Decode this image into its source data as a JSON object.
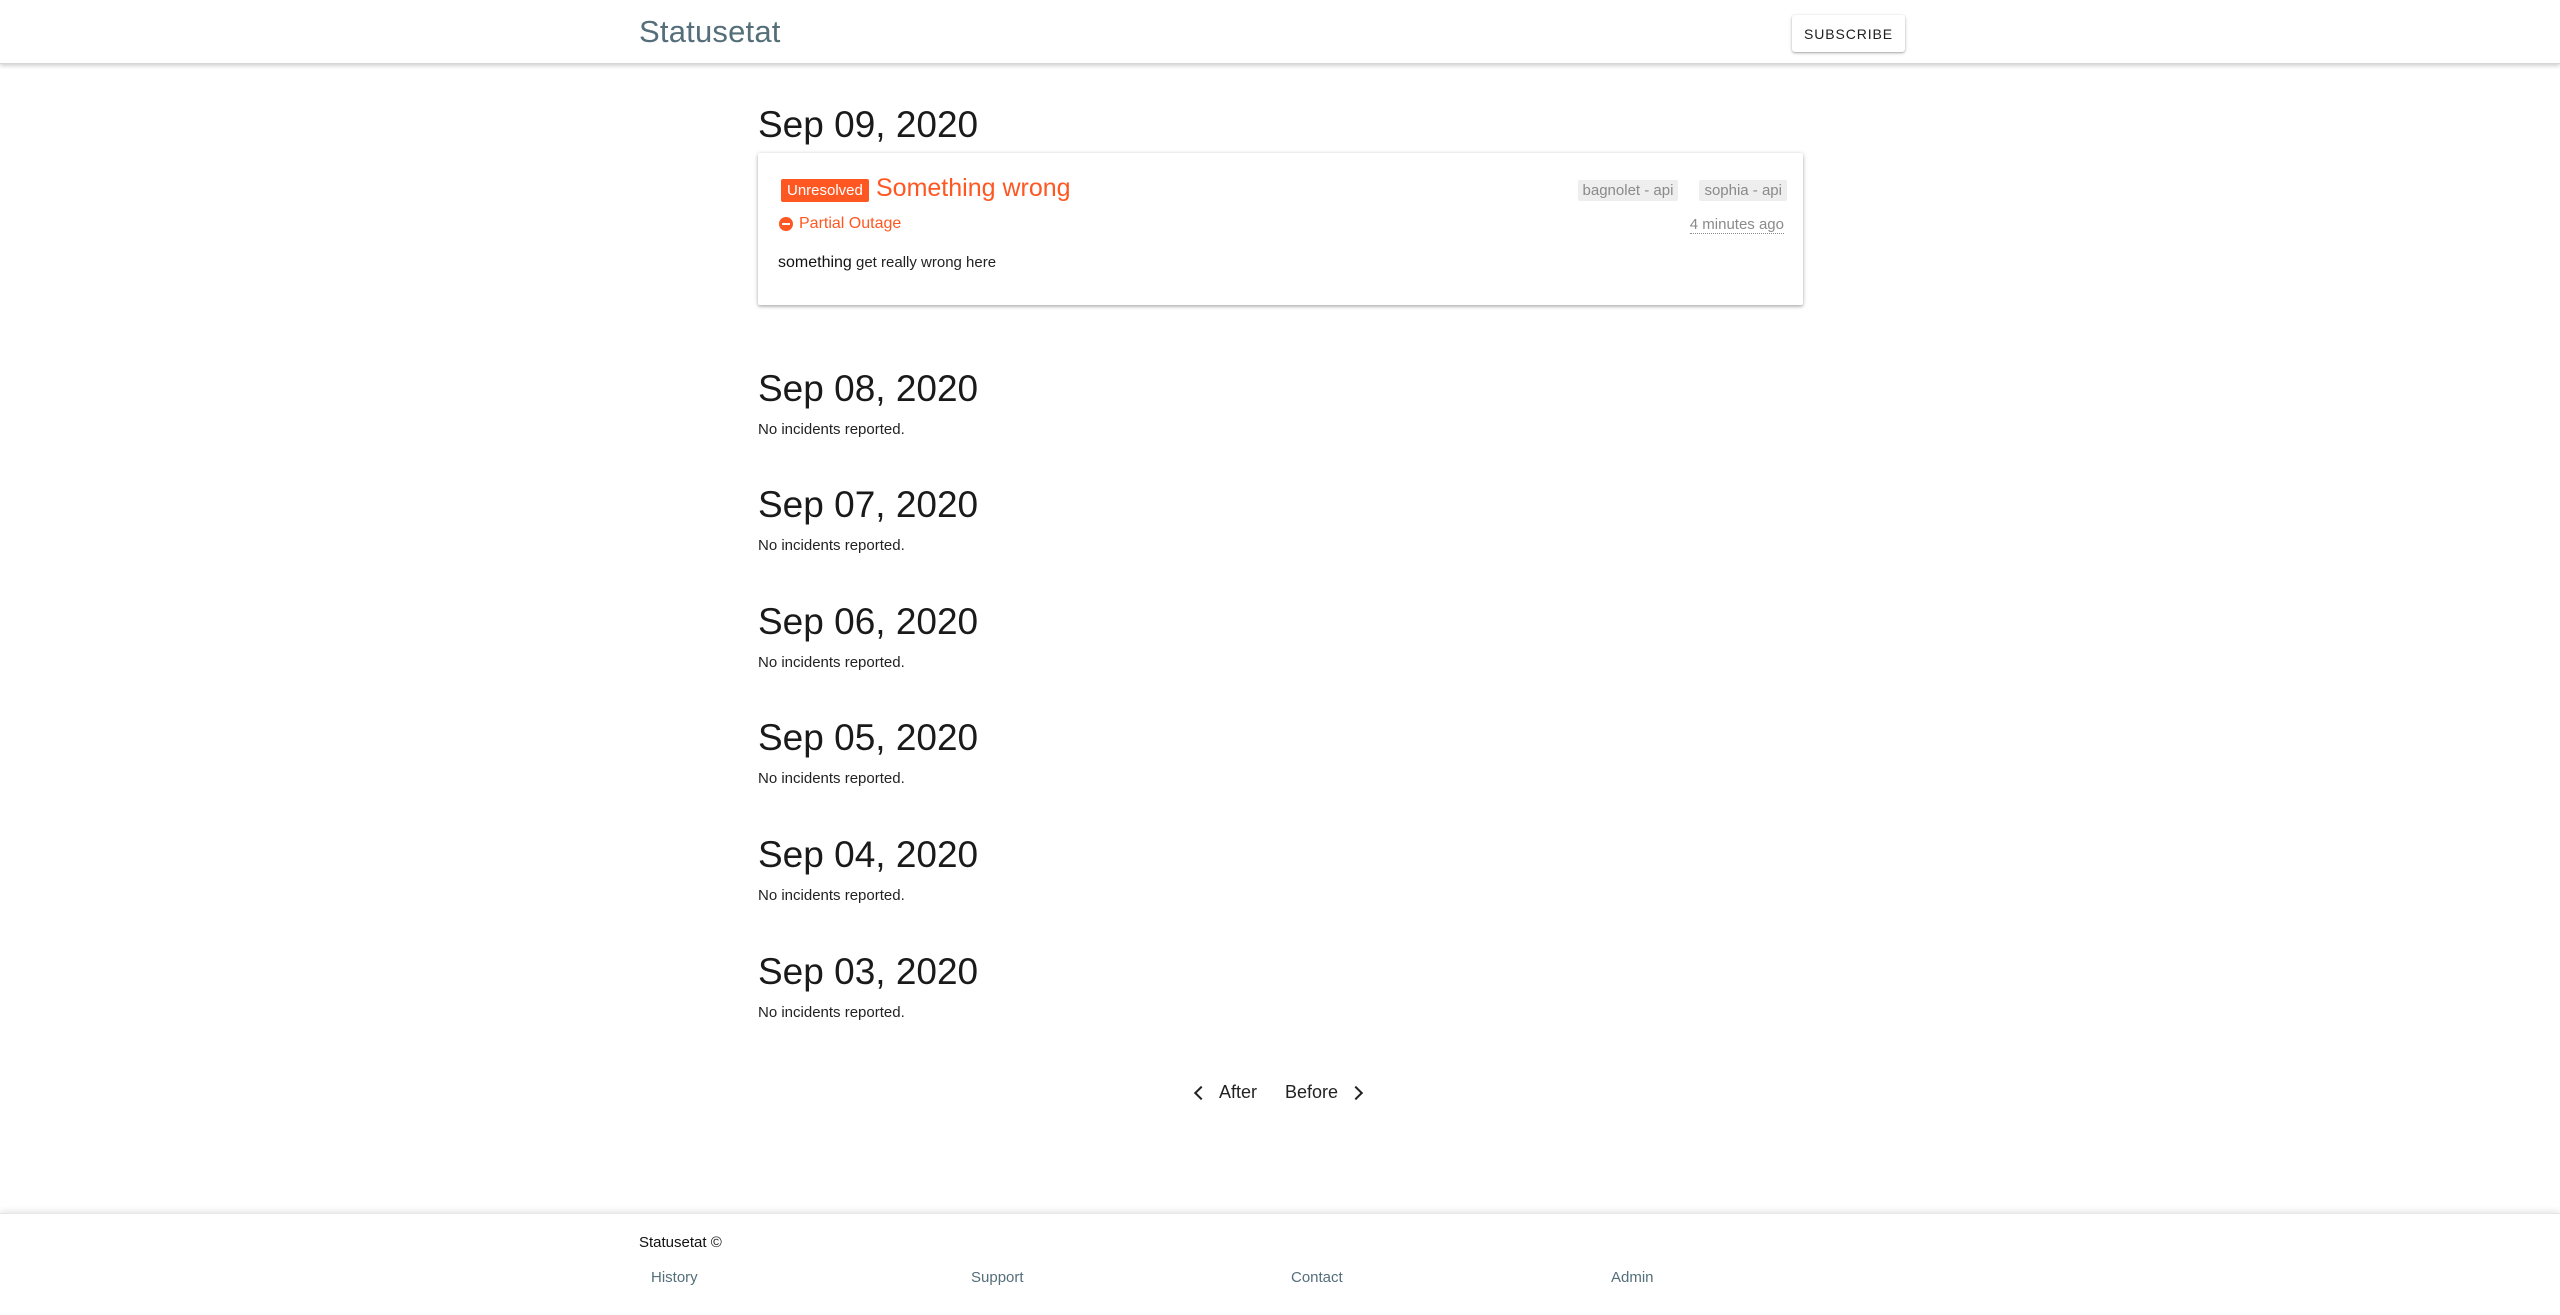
{
  "header": {
    "brand": "Statusetat",
    "subscribe_label": "SUBSCRIBE"
  },
  "days": [
    {
      "date": "Sep 09, 2020",
      "incidents": [
        {
          "state_badge": "Unresolved",
          "title": "Something wrong",
          "status": "Partial Outage",
          "body_strong": "something",
          "body_rest": " get really wrong here",
          "tags": [
            "bagnolet - api",
            "sophia - api"
          ],
          "time_ago": "4 minutes ago"
        }
      ]
    },
    {
      "date": "Sep 08, 2020",
      "message": "No incidents reported."
    },
    {
      "date": "Sep 07, 2020",
      "message": "No incidents reported."
    },
    {
      "date": "Sep 06, 2020",
      "message": "No incidents reported."
    },
    {
      "date": "Sep 05, 2020",
      "message": "No incidents reported."
    },
    {
      "date": "Sep 04, 2020",
      "message": "No incidents reported."
    },
    {
      "date": "Sep 03, 2020",
      "message": "No incidents reported."
    }
  ],
  "pager": {
    "after_label": "After",
    "before_label": "Before"
  },
  "footer": {
    "copyright": "Statusetat ©",
    "links": [
      "History",
      "Support",
      "Contact",
      "Admin"
    ]
  },
  "colors": {
    "accent": "#ff5722",
    "brand": "#546e7a"
  }
}
